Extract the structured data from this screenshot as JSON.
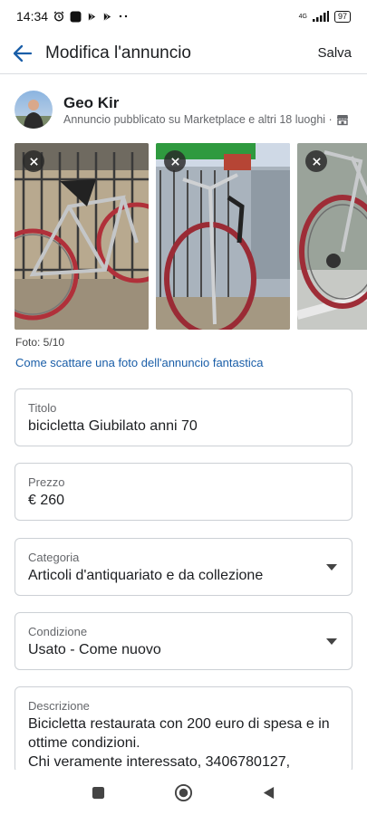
{
  "status_bar": {
    "time": "14:34",
    "network": "4G",
    "battery": "97"
  },
  "header": {
    "title": "Modifica l'annuncio",
    "save_label": "Salva"
  },
  "seller": {
    "name": "Geo Kir",
    "subtitle": "Annuncio pubblicato su Marketplace e altri 18 luoghi ·"
  },
  "photos": {
    "count_label": "Foto: 5/10",
    "tip_link": "Come scattare una foto dell'annuncio fantastica"
  },
  "form": {
    "title": {
      "label": "Titolo",
      "value": "bicicletta Giubilato anni 70"
    },
    "price": {
      "label": "Prezzo",
      "value": "€ 260"
    },
    "category": {
      "label": "Categoria",
      "value": "Articoli d'antiquariato e da collezione"
    },
    "condition": {
      "label": "Condizione",
      "value": "Usato - Come nuovo"
    },
    "description": {
      "label": "Descrizione",
      "value": "Bicicletta restaurata con 200 euro di spesa e in ottime condizioni.\nChi veramente interessato, 3406780127,"
    }
  },
  "icons": {
    "back": "arrow-left-icon",
    "shop": "shop-icon",
    "close": "close-icon",
    "dropdown": "caret-down-icon"
  },
  "colors": {
    "accent": "#1a5ea8",
    "border": "#ccd0d5",
    "secondary_text": "#65676b"
  }
}
